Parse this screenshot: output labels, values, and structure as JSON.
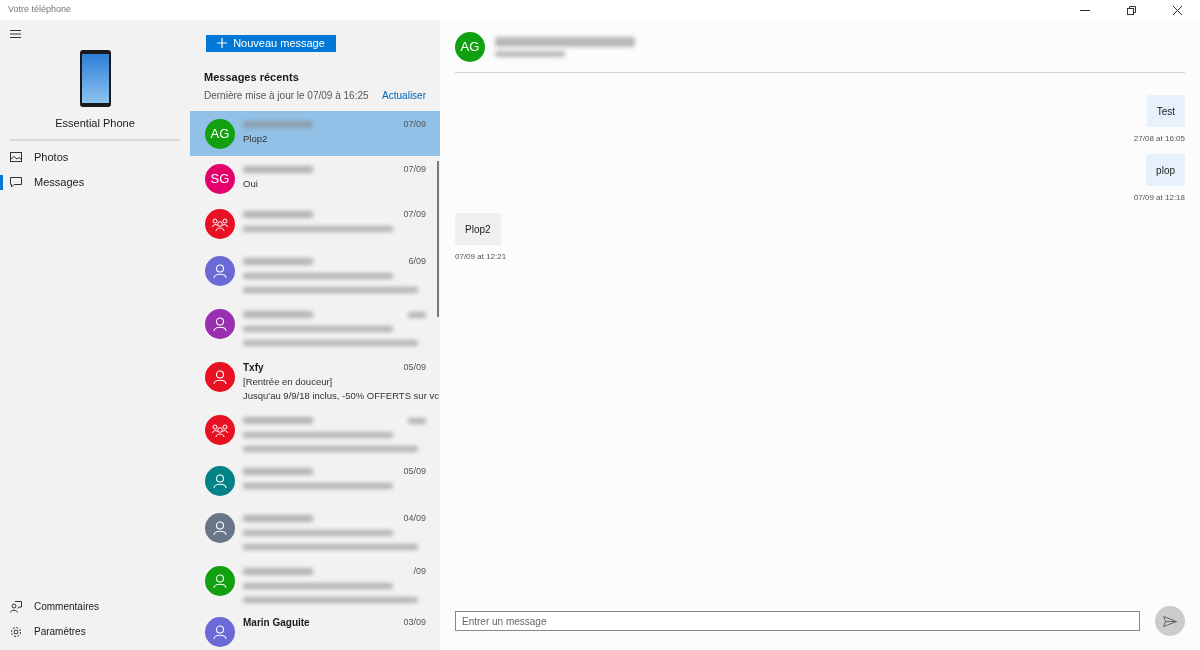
{
  "window": {
    "title": "Votre téléphone"
  },
  "device": {
    "name": "Essential Phone"
  },
  "nav": [
    {
      "kind": "photos",
      "label": "Photos",
      "selected": false
    },
    {
      "kind": "messages",
      "label": "Messages",
      "selected": true
    }
  ],
  "footer_nav": [
    {
      "kind": "feedback",
      "label": "Commentaires"
    },
    {
      "kind": "settings",
      "label": "Paramètres"
    }
  ],
  "new_message_button": {
    "label": "Nouveau message"
  },
  "recent": {
    "title": "Messages récents",
    "updated": "Dernière mise à jour le 07/09 à 16:25",
    "refresh": "Actualiser"
  },
  "conversations": [
    {
      "avatar": {
        "kind": "initials",
        "text": "AG"
      },
      "color": "#10a010",
      "name": {
        "kind": "blurred"
      },
      "preview": [
        {
          "kind": "text",
          "text": "Plop2"
        }
      ],
      "date": {
        "kind": "text",
        "text": "07/09"
      },
      "selected": true
    },
    {
      "avatar": {
        "kind": "initials",
        "text": "SG"
      },
      "color": "#e3006b",
      "name": {
        "kind": "blurred"
      },
      "preview": [
        {
          "kind": "text",
          "text": "Oui"
        }
      ],
      "date": {
        "kind": "text",
        "text": "07/09"
      },
      "selected": false
    },
    {
      "avatar": {
        "kind": "group"
      },
      "color": "#e81123",
      "name": {
        "kind": "blurred"
      },
      "preview": [
        {
          "kind": "blurred"
        }
      ],
      "date": {
        "kind": "text",
        "text": "07/09"
      },
      "selected": false
    },
    {
      "avatar": {
        "kind": "person"
      },
      "color": "#6b69d6",
      "name": {
        "kind": "blurred"
      },
      "preview": [
        {
          "kind": "blurred"
        },
        {
          "kind": "blurred"
        }
      ],
      "date": {
        "kind": "text",
        "text": "6/09"
      },
      "selected": false
    },
    {
      "avatar": {
        "kind": "person"
      },
      "color": "#9a2eb0",
      "name": {
        "kind": "blurred"
      },
      "preview": [
        {
          "kind": "blurred"
        },
        {
          "kind": "blurred"
        }
      ],
      "date": {
        "kind": "blurred"
      },
      "selected": false
    },
    {
      "avatar": {
        "kind": "person"
      },
      "color": "#e81123",
      "name": {
        "kind": "text",
        "text": "Txfy"
      },
      "preview": [
        {
          "kind": "text",
          "text": "[Rentrée en douceur]"
        },
        {
          "kind": "text",
          "text": "Jusqu'au 9/9/18 inclus, -50% OFFERTS sur vc"
        }
      ],
      "date": {
        "kind": "text",
        "text": "05/09"
      },
      "selected": false
    },
    {
      "avatar": {
        "kind": "group"
      },
      "color": "#e81123",
      "name": {
        "kind": "blurred"
      },
      "preview": [
        {
          "kind": "blurred"
        },
        {
          "kind": "blurred"
        }
      ],
      "date": {
        "kind": "blurred"
      },
      "selected": false
    },
    {
      "avatar": {
        "kind": "person"
      },
      "color": "#038387",
      "name": {
        "kind": "blurred"
      },
      "preview": [
        {
          "kind": "blurred"
        }
      ],
      "date": {
        "kind": "text",
        "text": "05/09"
      },
      "selected": false
    },
    {
      "avatar": {
        "kind": "person"
      },
      "color": "#68768a",
      "name": {
        "kind": "blurred"
      },
      "preview": [
        {
          "kind": "blurred"
        },
        {
          "kind": "blurred"
        }
      ],
      "date": {
        "kind": "text",
        "text": "04/09"
      },
      "selected": false
    },
    {
      "avatar": {
        "kind": "person"
      },
      "color": "#10a010",
      "name": {
        "kind": "blurred"
      },
      "preview": [
        {
          "kind": "blurred"
        },
        {
          "kind": "blurred"
        }
      ],
      "date": {
        "kind": "text",
        "text": "/09"
      },
      "selected": false
    },
    {
      "avatar": {
        "kind": "person"
      },
      "color": "#6b69d6",
      "name": {
        "kind": "text",
        "text": "Marin Gaguite"
      },
      "date": {
        "kind": "text",
        "text": "03/09"
      },
      "selected": false
    }
  ],
  "chat": {
    "contact": {
      "avatar": {
        "kind": "initials",
        "text": "AG"
      },
      "color": "#10a010",
      "name": {
        "kind": "blurred"
      },
      "number": {
        "kind": "blurred"
      }
    },
    "messages": [
      {
        "kind": "sent",
        "text": "Test",
        "time": "27/08 at 16:05"
      },
      {
        "kind": "sent",
        "text": "plop",
        "time": "07/09 at 12:18"
      },
      {
        "kind": "received",
        "text": "Plop2",
        "time": "07/09 at 12:21"
      }
    ],
    "input": {
      "placeholder": "Entrer un message"
    }
  }
}
